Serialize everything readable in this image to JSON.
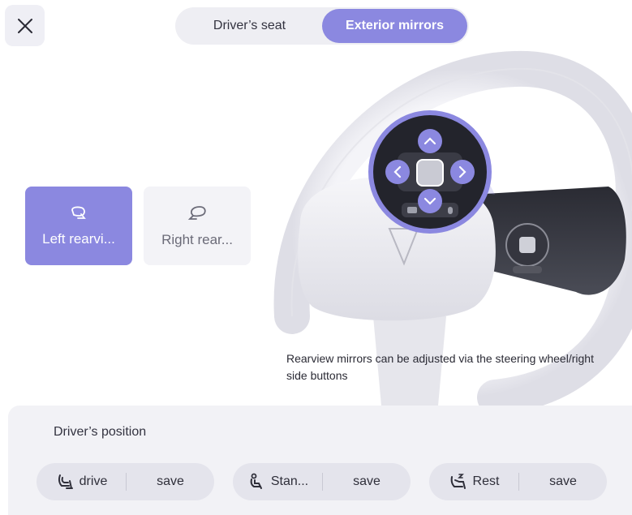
{
  "header": {
    "close_icon": "close-icon",
    "tabs": [
      {
        "label": "Driver’s seat",
        "active": false
      },
      {
        "label": "Exterior mirrors",
        "active": true
      }
    ]
  },
  "mirrors": [
    {
      "label": "Left rearvi...",
      "icon": "mirror-left-icon",
      "selected": true
    },
    {
      "label": "Right rear...",
      "icon": "mirror-right-icon",
      "selected": false
    }
  ],
  "hint": "Rearview mirrors can be adjusted via the steering wheel/right side buttons",
  "driver_position": {
    "title": "Driver’s position",
    "presets": [
      {
        "label": "drive",
        "icon": "seat-drive-icon",
        "save_label": "save"
      },
      {
        "label": "Stan...",
        "icon": "seat-standard-icon",
        "save_label": "save"
      },
      {
        "label": "Rest",
        "icon": "seat-rest-icon",
        "save_label": "save"
      }
    ]
  },
  "colors": {
    "accent": "#8b88e0",
    "panel": "#f2f2f6"
  }
}
